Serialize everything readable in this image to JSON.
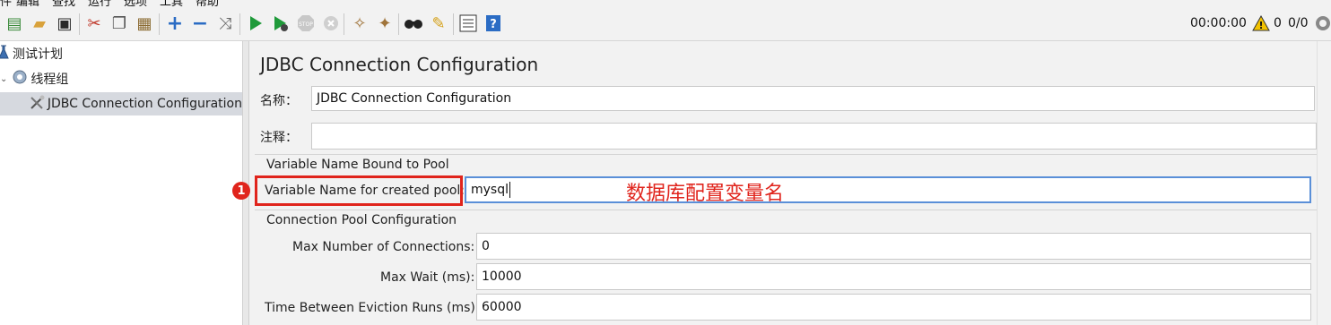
{
  "menubar": {
    "items": [
      "件",
      "编辑",
      "查找",
      "运行",
      "选项",
      "工具",
      "帮助"
    ]
  },
  "toolbar": {
    "buttons": [
      {
        "name": "templates-icon",
        "glyph": "▤",
        "color": "#3b8a3b"
      },
      {
        "name": "open-icon",
        "glyph": "▰",
        "color": "#d9a23b"
      },
      {
        "name": "save-icon",
        "glyph": "▣",
        "color": "#2a2a2a"
      },
      {
        "name": "cut-icon",
        "glyph": "✂",
        "color": "#c0392b"
      },
      {
        "name": "copy-icon",
        "glyph": "❐",
        "color": "#555"
      },
      {
        "name": "paste-icon",
        "glyph": "▦",
        "color": "#8a6a30"
      },
      {
        "name": "expand-icon",
        "glyph": "+",
        "color": "#2b6cc4"
      },
      {
        "name": "collapse-icon",
        "glyph": "−",
        "color": "#2b6cc4"
      },
      {
        "name": "toggle-icon",
        "glyph": "⤨",
        "color": "#666"
      },
      {
        "name": "start-icon",
        "glyph": "▶",
        "color": "#1f9a3a"
      },
      {
        "name": "start-no-pause-icon",
        "glyph": "▶",
        "color": "#1f9a3a"
      },
      {
        "name": "stop-icon",
        "glyph": "⬢",
        "color": "#bdbdbd"
      },
      {
        "name": "shutdown-icon",
        "glyph": "✖",
        "color": "#c9c9c9"
      },
      {
        "name": "clear-icon",
        "glyph": "✧",
        "color": "#a0743a"
      },
      {
        "name": "clear-all-icon",
        "glyph": "✦",
        "color": "#a0743a"
      },
      {
        "name": "search-icon",
        "glyph": "⚲",
        "color": "#222"
      },
      {
        "name": "reset-search-icon",
        "glyph": "✎",
        "color": "#d4a017"
      },
      {
        "name": "function-helper-icon",
        "glyph": "☰",
        "color": "#333"
      },
      {
        "name": "help-icon",
        "glyph": "?",
        "color": "#ffffff"
      }
    ],
    "timer": "00:00:00",
    "warning_count": "0",
    "thread_ratio": "0/0",
    "colors": {
      "play": "#1f9a3a",
      "warning": "#f2c200"
    }
  },
  "tree": {
    "items": [
      {
        "label": "测试计划",
        "icon": "flask-icon"
      },
      {
        "label": "线程组",
        "icon": "gear-icon"
      },
      {
        "label": "JDBC Connection Configuration",
        "icon": "tools-icon"
      }
    ]
  },
  "panel": {
    "title": "JDBC Connection Configuration",
    "name_label": "名称：",
    "name_value": "JDBC Connection Configuration",
    "comment_label": "注释：",
    "comment_value": "",
    "section_variable": "Variable Name Bound to Pool",
    "variable_label": "Variable Name for created pool:",
    "variable_value": "mysql",
    "section_pool": "Connection Pool Configuration",
    "max_connections_label": "Max Number of Connections:",
    "max_connections_value": "0",
    "max_wait_label": "Max Wait (ms):",
    "max_wait_value": "10000",
    "eviction_label": "Time Between Eviction Runs (ms):",
    "eviction_value": "60000"
  },
  "annotation": {
    "badge": "1",
    "note": "数据库配置变量名",
    "color": "#e0241c"
  }
}
